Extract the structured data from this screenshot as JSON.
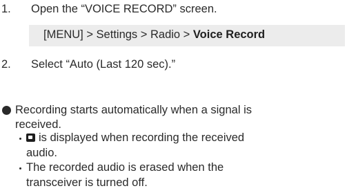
{
  "steps": [
    {
      "number": "1.",
      "text": "Open the “VOICE RECORD” screen."
    },
    {
      "number": "2.",
      "text": "Select “Auto (Last 120 sec).”"
    }
  ],
  "menu_path": {
    "prefix": "[MENU] > Settings > Radio > ",
    "bold": "Voice Record"
  },
  "note": {
    "line1": "Recording starts automatically when a signal is",
    "line2": "received.",
    "sub1": {
      "icon": "record-icon",
      "line1": "is displayed when recording the received",
      "line2": "audio."
    },
    "sub2": {
      "line1": "The recorded audio is erased when the",
      "line2": "transceiver is turned off."
    }
  }
}
